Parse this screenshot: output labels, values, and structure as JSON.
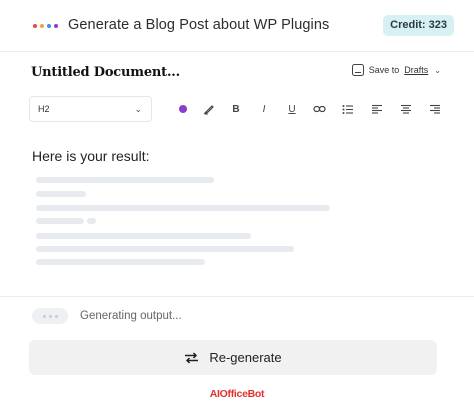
{
  "header": {
    "title": "Generate a Blog Post about WP Plugins",
    "credit": "Credit: 323",
    "logo_dot_colors": [
      "#e84a3f",
      "#f2a33a",
      "#3d8ee8",
      "#8b3fc8"
    ]
  },
  "document": {
    "title": "Untitled Document...",
    "save_prefix": "Save to",
    "save_target": "Drafts",
    "save_icon": "folder-icon",
    "chevron": "⌄"
  },
  "toolbar": {
    "heading_value": "H2",
    "heading_chevron": "⌄",
    "color_value": "#8b3fc8",
    "bold": "B",
    "italic": "I",
    "underline": "U",
    "link_icon": "⊂⊃",
    "list_icon": "☰",
    "align_left_icon": "≡",
    "align_center_icon": "≡",
    "align_right_icon": "≡"
  },
  "result": {
    "heading": "Here is your result:"
  },
  "status": {
    "text": "Generating output..."
  },
  "actions": {
    "regenerate_label": "Re-generate",
    "regenerate_icon": "⇄"
  },
  "footer": {
    "brand": "AIOfficeBot"
  }
}
